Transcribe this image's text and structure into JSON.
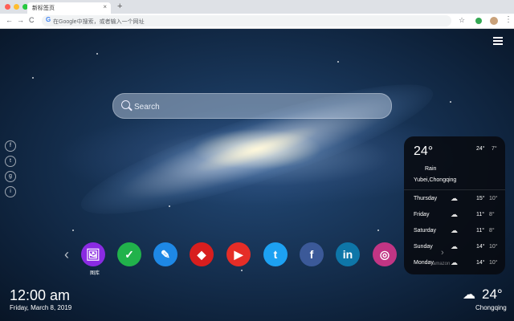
{
  "browser": {
    "tab_title": "新标签页",
    "tab_close": "×",
    "new_tab": "+",
    "back": "←",
    "forward": "→",
    "reload": "C",
    "omnibox_g": "G",
    "omnibox_placeholder": "在Google中搜索，或者输入一个网址",
    "bookmark_star": "☆",
    "menu": "⋮",
    "traffic_colors": [
      "#ff5f56",
      "#ffbd2e",
      "#27c93f"
    ]
  },
  "search": {
    "placeholder": "Search"
  },
  "social": [
    "f",
    "t",
    "g",
    "i"
  ],
  "dock": {
    "apps": [
      {
        "icon": "image-icon",
        "glyph": "🖼",
        "color": "#8a2be2",
        "label": "图库"
      },
      {
        "icon": "check-icon",
        "glyph": "✓",
        "color": "#21b24b",
        "label": ""
      },
      {
        "icon": "notes-icon",
        "glyph": "✎",
        "color": "#1e88e5",
        "label": ""
      },
      {
        "icon": "game-icon",
        "glyph": "◆",
        "color": "#d81e1e",
        "label": ""
      },
      {
        "icon": "youtube-icon",
        "glyph": "▶",
        "color": "#e52d27",
        "label": ""
      },
      {
        "icon": "twitter-icon",
        "glyph": "t",
        "color": "#1da1f2",
        "label": ""
      },
      {
        "icon": "facebook-icon",
        "glyph": "f",
        "color": "#3b5998",
        "label": ""
      },
      {
        "icon": "linkedin-icon",
        "glyph": "in",
        "color": "#0e76a8",
        "label": ""
      },
      {
        "icon": "instagram-icon",
        "glyph": "◎",
        "color": "#c13584",
        "label": ""
      }
    ],
    "prev": "‹",
    "next": "›"
  },
  "clock": {
    "time": "12:00 am",
    "date": "Friday, March 8, 2019"
  },
  "weather": {
    "temp": "24°",
    "hi": "24°",
    "lo": "7°",
    "condition": "Rain",
    "location": "Yubei,Chongqing",
    "city": "Chongqing",
    "icon": "cloud-icon",
    "glyph": "☁",
    "forecast": [
      {
        "day": "Thursday",
        "hi": "15°",
        "lo": "10°"
      },
      {
        "day": "Friday",
        "hi": "11°",
        "lo": "8°"
      },
      {
        "day": "Saturday",
        "hi": "11°",
        "lo": "8°"
      },
      {
        "day": "Sunday",
        "hi": "14°",
        "lo": "10°"
      },
      {
        "day": "Monday",
        "hi": "14°",
        "lo": "10°"
      }
    ],
    "source": "amazon"
  }
}
